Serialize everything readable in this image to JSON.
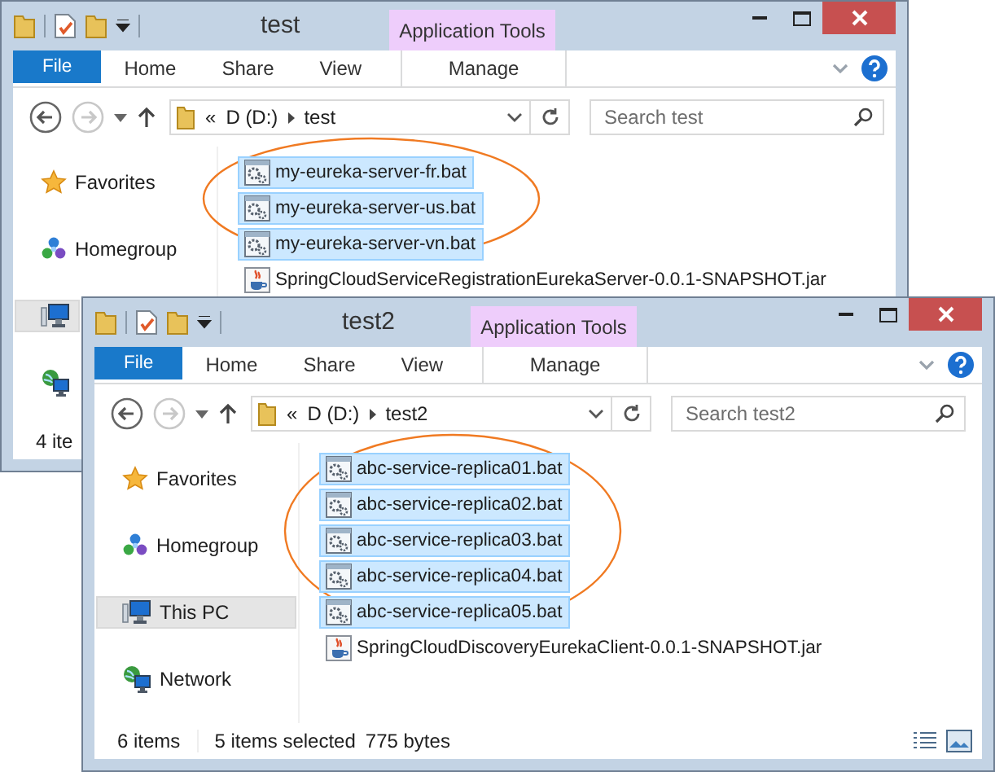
{
  "windows": [
    {
      "title": "test",
      "context_tab": "Application Tools",
      "tabs": [
        {
          "label": "File",
          "kind": "file"
        },
        {
          "label": "Home",
          "kind": "plain"
        },
        {
          "label": "Share",
          "kind": "plain"
        },
        {
          "label": "View",
          "kind": "plain"
        },
        {
          "label": "Manage",
          "kind": "context"
        }
      ],
      "address": {
        "overflow": "«",
        "crumbs": [
          "D (D:)",
          "test"
        ]
      },
      "search": {
        "placeholder": "Search test"
      },
      "nav": [
        {
          "label": "Favorites",
          "kind": "star",
          "selected": false
        },
        {
          "label": "Homegroup",
          "kind": "homegroup",
          "selected": false
        },
        {
          "kind": "pc",
          "selected": true
        },
        {
          "kind": "network",
          "selected": false
        }
      ],
      "files": [
        {
          "name": "my-eureka-server-fr.bat",
          "kind": "bat",
          "selected": true
        },
        {
          "name": "my-eureka-server-us.bat",
          "kind": "bat",
          "selected": true
        },
        {
          "name": "my-eureka-server-vn.bat",
          "kind": "bat",
          "selected": true
        },
        {
          "name": "SpringCloudServiceRegistrationEurekaServer-0.0.1-SNAPSHOT.jar",
          "kind": "jar",
          "selected": false
        }
      ],
      "status": {
        "count": "4 ite"
      }
    },
    {
      "title": "test2",
      "context_tab": "Application Tools",
      "tabs": [
        {
          "label": "File",
          "kind": "file"
        },
        {
          "label": "Home",
          "kind": "plain"
        },
        {
          "label": "Share",
          "kind": "plain"
        },
        {
          "label": "View",
          "kind": "plain"
        },
        {
          "label": "Manage",
          "kind": "context"
        }
      ],
      "address": {
        "overflow": "«",
        "crumbs": [
          "D (D:)",
          "test2"
        ]
      },
      "search": {
        "placeholder": "Search test2"
      },
      "nav": [
        {
          "label": "Favorites",
          "kind": "star",
          "selected": false
        },
        {
          "label": "Homegroup",
          "kind": "homegroup",
          "selected": false
        },
        {
          "label": "This PC",
          "kind": "pc",
          "selected": true
        },
        {
          "label": "Network",
          "kind": "network",
          "selected": false
        }
      ],
      "files": [
        {
          "name": "abc-service-replica01.bat",
          "kind": "bat",
          "selected": true
        },
        {
          "name": "abc-service-replica02.bat",
          "kind": "bat",
          "selected": true
        },
        {
          "name": "abc-service-replica03.bat",
          "kind": "bat",
          "selected": true
        },
        {
          "name": "abc-service-replica04.bat",
          "kind": "bat",
          "selected": true
        },
        {
          "name": "abc-service-replica05.bat",
          "kind": "bat",
          "selected": true
        },
        {
          "name": "SpringCloudDiscoveryEurekaClient-0.0.1-SNAPSHOT.jar",
          "kind": "jar",
          "selected": false
        }
      ],
      "status": {
        "count": "6 items",
        "selection": "5 items selected",
        "size": "775 bytes",
        "view_icons": true
      }
    }
  ]
}
